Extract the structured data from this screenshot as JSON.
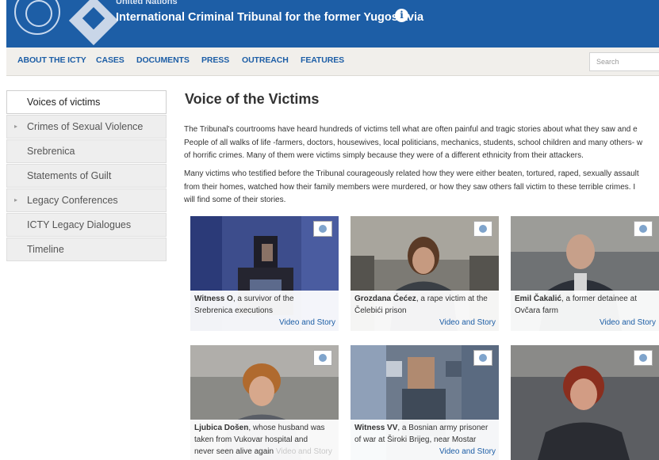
{
  "header": {
    "subtitle": "United Nations",
    "title": "International Criminal Tribunal for the former Yugoslavia",
    "info_icon": "info-icon"
  },
  "nav": {
    "items": [
      "ABOUT THE ICTY",
      "CASES",
      "DOCUMENTS",
      "PRESS",
      "OUTREACH",
      "FEATURES"
    ],
    "search_placeholder": "Search"
  },
  "sidebar": {
    "items": [
      {
        "label": "Voices of victims",
        "active": true,
        "has_arrow": false
      },
      {
        "label": "Crimes of Sexual Violence",
        "active": false,
        "has_arrow": true
      },
      {
        "label": "Srebrenica",
        "active": false,
        "has_arrow": false
      },
      {
        "label": "Statements of Guilt",
        "active": false,
        "has_arrow": false
      },
      {
        "label": "Legacy Conferences",
        "active": false,
        "has_arrow": true
      },
      {
        "label": "ICTY Legacy Dialogues",
        "active": false,
        "has_arrow": false
      },
      {
        "label": "Timeline",
        "active": false,
        "has_arrow": false
      }
    ]
  },
  "main": {
    "title": "Voice of the Victims",
    "para1": [
      "The Tribunal's courtrooms have heard hundreds of victims tell what are often painful and tragic stories about what they saw and e",
      "People of all walks of life -farmers, doctors, housewives, local politicians, mechanics, students, school children and many others- w",
      "of horrific crimes. Many of them were victims simply because they were of a different ethnicity from their attackers."
    ],
    "para2": [
      "Many victims who testified before the Tribunal courageously related how they were either beaten, tortured, raped, sexually assault",
      "from their homes, watched how their family members were murdered, or how they saw others fall victim to these terrible crimes. I",
      "will find some of their stories."
    ]
  },
  "cards": [
    {
      "name": "Witness O",
      "desc_line1": ", a survivor of the",
      "desc_line2": "Srebrenica executions",
      "link": "Video and Story"
    },
    {
      "name": "Grozdana Ćećez",
      "desc_line1": ", a rape victim at the",
      "desc_line2": "Čelebići prison",
      "link": "Video and Story"
    },
    {
      "name": "Emil Čakalić",
      "desc_line1": ", a former detainee at",
      "desc_line2": "Ovčara farm",
      "link": "Video and Story"
    },
    {
      "name": "Ljubica Došen",
      "desc_line1": ", whose husband was",
      "desc_line2": "taken from Vukovar hospital and",
      "desc_line3": "never seen alive again",
      "link": "Video and Story"
    },
    {
      "name": "Witness VV",
      "desc_line1": ", a Bosnian army prisoner",
      "desc_line2": "of war at Široki Brijeg, near Mostar",
      "link": "Video and Story"
    }
  ]
}
